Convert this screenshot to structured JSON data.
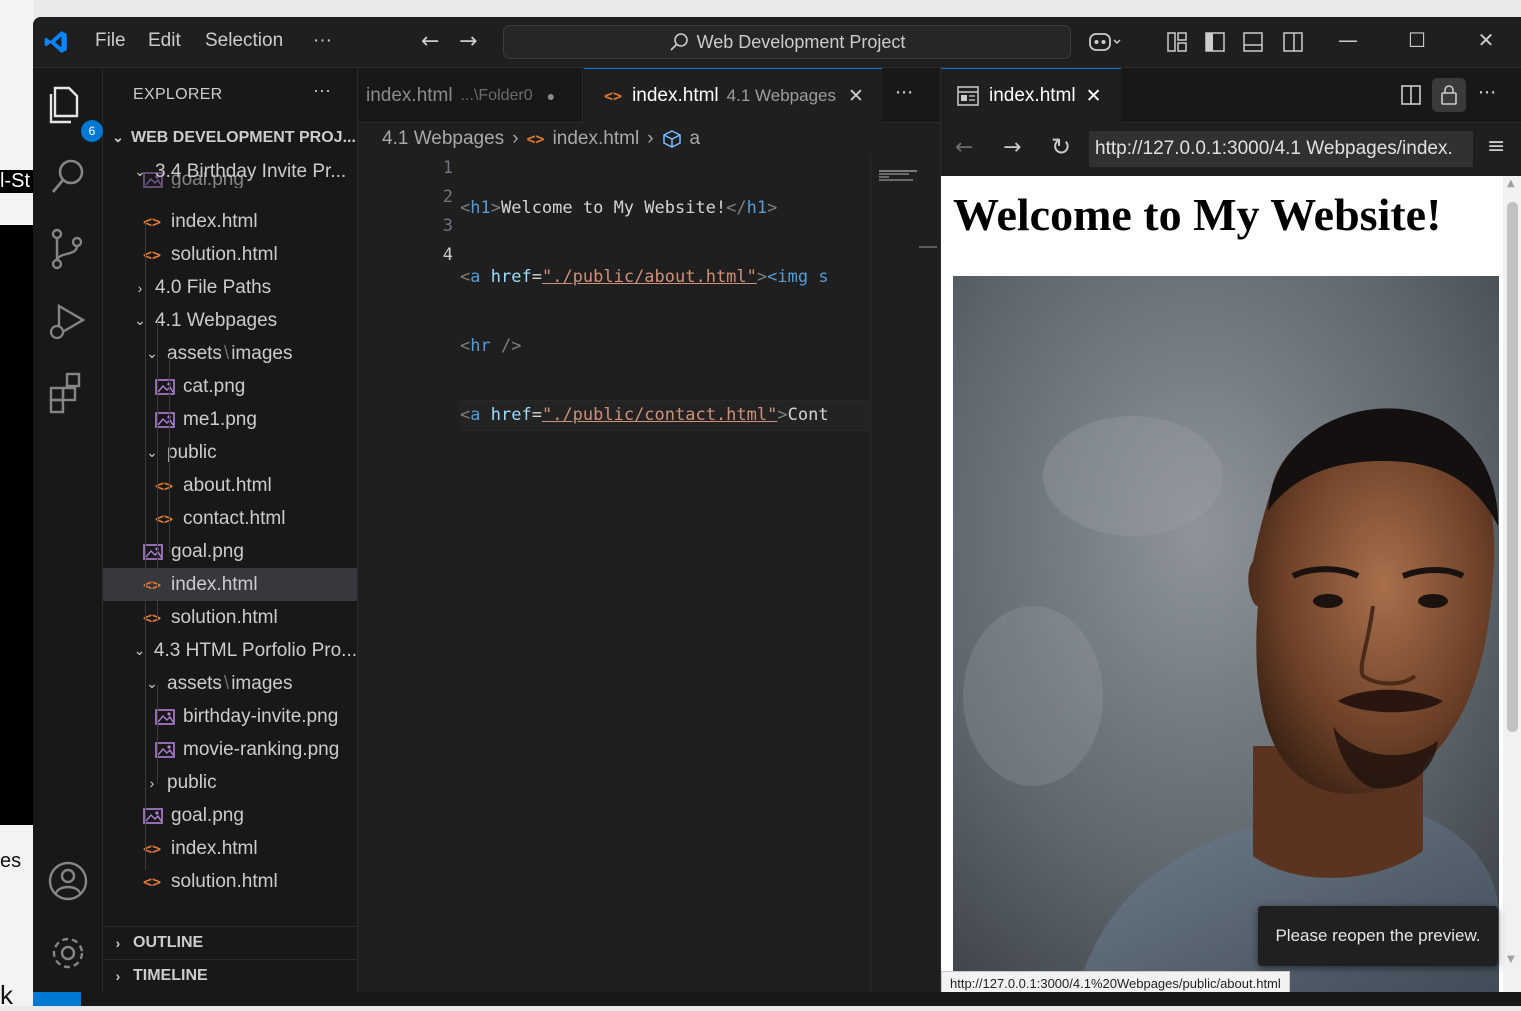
{
  "background": {
    "left_fragment": "l-St",
    "mid_fragment": "es",
    "bottom_fragment": "k"
  },
  "titlebar": {
    "menu": [
      "File",
      "Edit",
      "Selection",
      "···"
    ],
    "command_center": "Web Development Project"
  },
  "activity": {
    "explorer_badge": "6"
  },
  "sidebar": {
    "title": "EXPLORER",
    "more": "···",
    "root": "WEB DEVELOPMENT PROJ...",
    "items": [
      {
        "label": "3.4 Birthday Invite Pr...",
        "kind": "folder-open"
      },
      {
        "label": "goal.png",
        "kind": "png"
      },
      {
        "label": "index.html",
        "kind": "html"
      },
      {
        "label": "solution.html",
        "kind": "html"
      },
      {
        "label": "4.0 File Paths",
        "kind": "folder-closed"
      },
      {
        "label": "4.1 Webpages",
        "kind": "folder-open"
      },
      {
        "label": "assets",
        "sub": "images",
        "kind": "folder-open"
      },
      {
        "label": "cat.png",
        "kind": "png"
      },
      {
        "label": "me1.png",
        "kind": "png"
      },
      {
        "label": "public",
        "kind": "folder-open"
      },
      {
        "label": "about.html",
        "kind": "html"
      },
      {
        "label": "contact.html",
        "kind": "html"
      },
      {
        "label": "goal.png",
        "kind": "png"
      },
      {
        "label": "index.html",
        "kind": "html",
        "selected": true
      },
      {
        "label": "solution.html",
        "kind": "html"
      },
      {
        "label": "4.3 HTML Porfolio Pro...",
        "kind": "folder-open"
      },
      {
        "label": "assets",
        "sub": "images",
        "kind": "folder-open"
      },
      {
        "label": "birthday-invite.png",
        "kind": "png"
      },
      {
        "label": "movie-ranking.png",
        "kind": "png"
      },
      {
        "label": "public",
        "kind": "folder-closed"
      },
      {
        "label": "goal.png",
        "kind": "png"
      },
      {
        "label": "index.html",
        "kind": "html"
      },
      {
        "label": "solution.html",
        "kind": "html"
      }
    ],
    "outline": "OUTLINE",
    "timeline": "TIMELINE"
  },
  "editor": {
    "tab1": {
      "name": "index.html",
      "path": "...\\Folder0"
    },
    "tab2": {
      "name": "index.html",
      "path": "4.1 Webpages"
    },
    "more": "···",
    "breadcrumb": [
      "4.1 Webpages",
      "index.html",
      "a"
    ],
    "line_numbers": [
      "1",
      "2",
      "3",
      "4"
    ],
    "code": {
      "l1_text": "Welcome to My Website!",
      "l2_href": "\"./public/about.html\"",
      "l2_tail": "<img s",
      "l4_href": "\"./public/contact.html\"",
      "l4_tail": "Cont"
    }
  },
  "preview": {
    "tab_title": "index.html",
    "url": "http://127.0.0.1:3000/4.1 Webpages/index.",
    "heading": "Welcome to My Website!",
    "toast": "Please reopen the preview.",
    "hover_url": "http://127.0.0.1:3000/4.1%20Webpages/public/about.html"
  }
}
